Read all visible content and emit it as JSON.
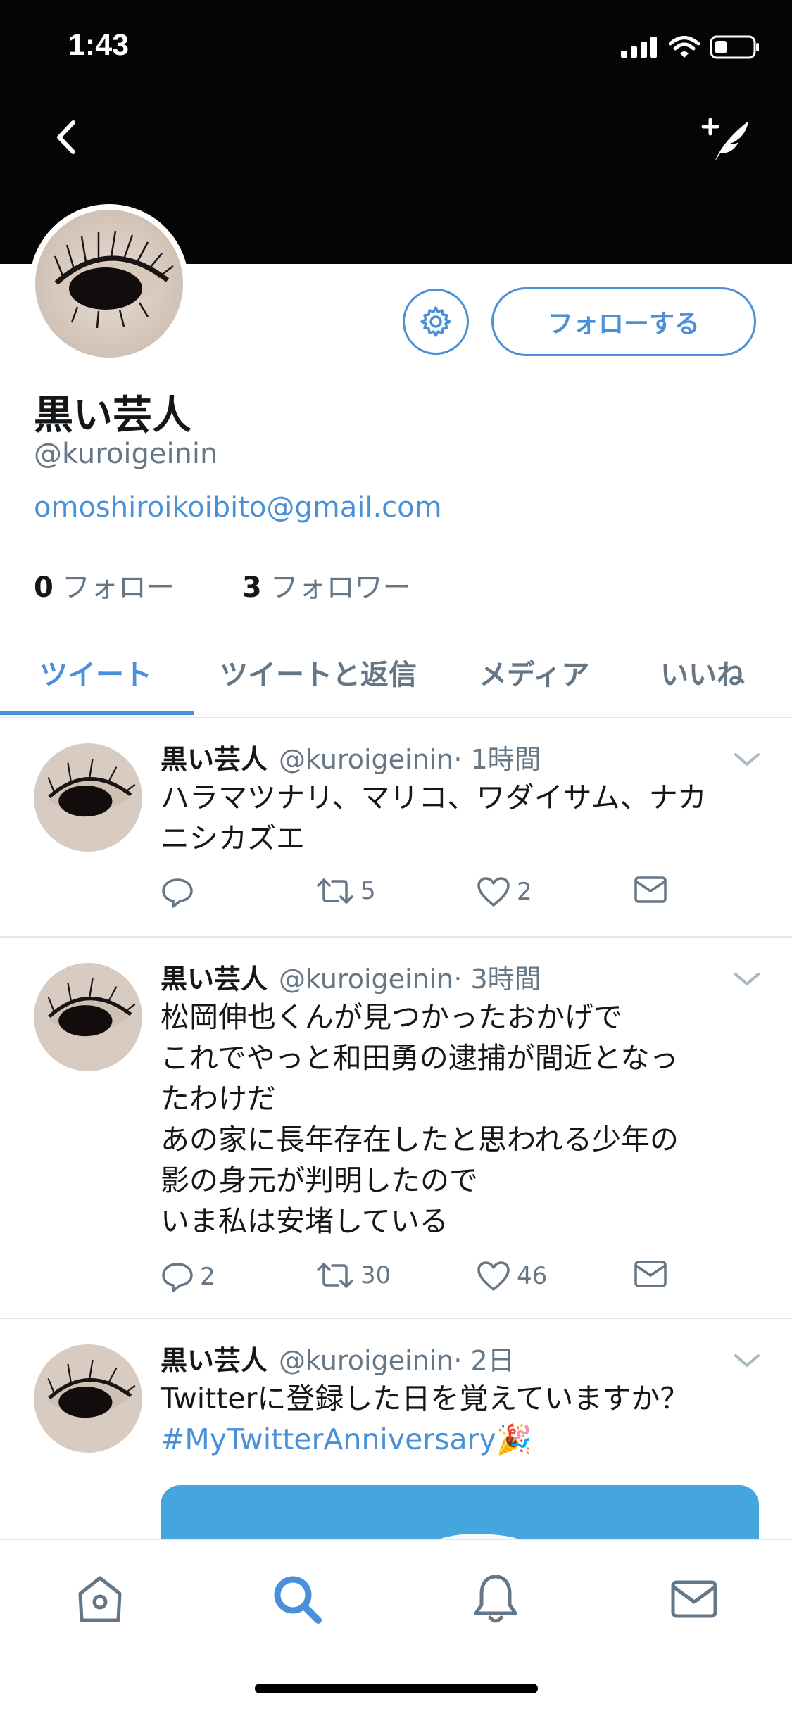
{
  "status_bar": {
    "time": "1:43"
  },
  "header": {
    "back_icon": "chevron-left-icon",
    "compose_icon": "compose-tweet-icon"
  },
  "profile": {
    "name": "黒い芸人",
    "handle": "@kuroigeinin",
    "link": "omoshiroikoibito@gmail.com",
    "following_count": "0",
    "following_label": "フォロー",
    "followers_count": "3",
    "followers_label": "フォロワー",
    "follow_button": "フォローする"
  },
  "tabs": [
    "ツイート",
    "ツイートと返信",
    "メディア",
    "いいね"
  ],
  "tweets": [
    {
      "name": "黒い芸人",
      "handle": "@kuroigeinin",
      "time": "· 1時間",
      "lines": [
        "ハラマツナリ、マリコ、ワダイサム、ナカ",
        "ニシカズエ"
      ],
      "replies": "",
      "retweets": "5",
      "likes": "2"
    },
    {
      "name": "黒い芸人",
      "handle": "@kuroigeinin",
      "time": "· 3時間",
      "lines": [
        "松岡伸也くんが見つかったおかげで",
        "これでやっと和田勇の逮捕が間近となっ",
        "たわけだ",
        "あの家に長年存在したと思われる少年の",
        "影の身元が判明したので",
        "いま私は安堵している"
      ],
      "replies": "2",
      "retweets": "30",
      "likes": "46"
    },
    {
      "name": "黒い芸人",
      "handle": "@kuroigeinin",
      "time": "· 2日",
      "lines": [
        "Twitterに登録した日を覚えていますか？"
      ],
      "hashtag": "#MyTwitterAnniversary",
      "emoji": "🎉"
    }
  ],
  "bottom_tabs": [
    "home-icon",
    "search-icon",
    "notifications-icon",
    "messages-icon"
  ],
  "colors": {
    "accent": "#4a90d9",
    "muted": "#657786",
    "header_bg": "#050505"
  }
}
